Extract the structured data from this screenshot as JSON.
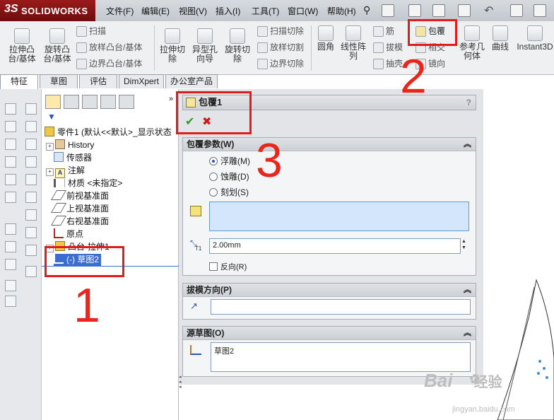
{
  "app": {
    "logo_ds": "3S",
    "logo_name": "SOLIDWORKS"
  },
  "menu": [
    "文件(F)",
    "编辑(E)",
    "视图(V)",
    "插入(I)",
    "工具(T)",
    "窗口(W)",
    "帮助(H)"
  ],
  "ribbon": {
    "extrude_boss": "拉伸凸\n台/基体",
    "revolve_boss": "旋转凸\n台/基体",
    "sweep": "扫描",
    "loft_boss": "放样凸台/基体",
    "boundary_boss": "边界凸台/基体",
    "extrude_cut": "拉伸切\n除",
    "hole_wizard": "异型孔\n向导",
    "revolve_cut": "旋转切\n除",
    "sweep_cut": "扫描切除",
    "loft_cut": "放样切割",
    "boundary_cut": "边界切除",
    "fillet": "圆角",
    "linear_pattern": "线性阵\n列",
    "rib": "筋",
    "draft": "拔模",
    "shell": "抽壳",
    "wrap": "包覆",
    "intersect": "相交",
    "mirror": "镜向",
    "ref_geometry": "参考几\n何体",
    "curves": "曲线",
    "instant3d": "Instant3D"
  },
  "tabs": [
    "特征",
    "草图",
    "评估",
    "DimXpert",
    "办公室产品"
  ],
  "tree": {
    "root": "零件1 (默认<<默认>_显示状态",
    "items": [
      "History",
      "传感器",
      "注解",
      "材质 <未指定>",
      "前视基准面",
      "上视基准面",
      "右视基准面",
      "原点",
      "凸台-拉伸1",
      "(-) 草图2"
    ]
  },
  "pm": {
    "title": "包覆1",
    "help": "?",
    "params_header": "包覆参数(W)",
    "opt_emboss": "浮雕(M)",
    "opt_deboss": "蚀雕(D)",
    "opt_scribe": "刻划(S)",
    "thickness": "2.00mm",
    "thickness_label": "T1",
    "reverse": "反向(R)",
    "pull_header": "拔模方向(P)",
    "source_header": "源草图(O)",
    "source_value": "草图2"
  },
  "annotations": {
    "one": "1",
    "two": "2",
    "three": "3"
  },
  "watermark": {
    "brand": "Bai",
    "brand2": "经验",
    "url": "jingyan.baidu.com"
  },
  "colors": {
    "annotation": "#e21b1b",
    "selection": "#3c6ecf",
    "brand_red": "#8b1414"
  }
}
